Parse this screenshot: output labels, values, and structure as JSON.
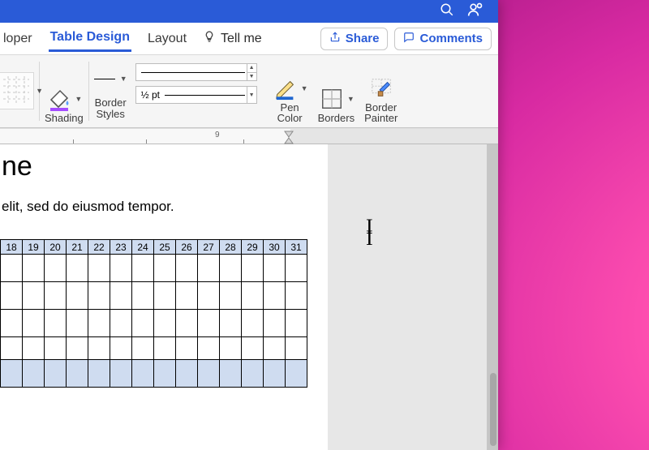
{
  "titlebar": {
    "search_icon": "search",
    "presence_icon": "presence"
  },
  "tabs": {
    "items": [
      "loper",
      "Table Design",
      "Layout"
    ],
    "active_index": 1,
    "tellme": "Tell me"
  },
  "actions": {
    "share": "Share",
    "comments": "Comments"
  },
  "ribbon": {
    "shading": "Shading",
    "border_styles": "Border\nStyles",
    "weight": "½ pt",
    "pen_color": "Pen\nColor",
    "borders": "Borders",
    "border_painter": "Border\nPainter"
  },
  "ruler": {
    "num": "9"
  },
  "document": {
    "heading_fragment": "ne",
    "body_fragment": "elit, sed do eiusmod tempor.",
    "table": {
      "headers": [
        "18",
        "19",
        "20",
        "21",
        "22",
        "23",
        "24",
        "25",
        "26",
        "27",
        "28",
        "29",
        "30",
        "31"
      ],
      "rows": 5
    }
  },
  "colors": {
    "accent": "#2a5bd7",
    "shading_swatch": "#a44cff",
    "pen_underline": "#1f66d0"
  }
}
